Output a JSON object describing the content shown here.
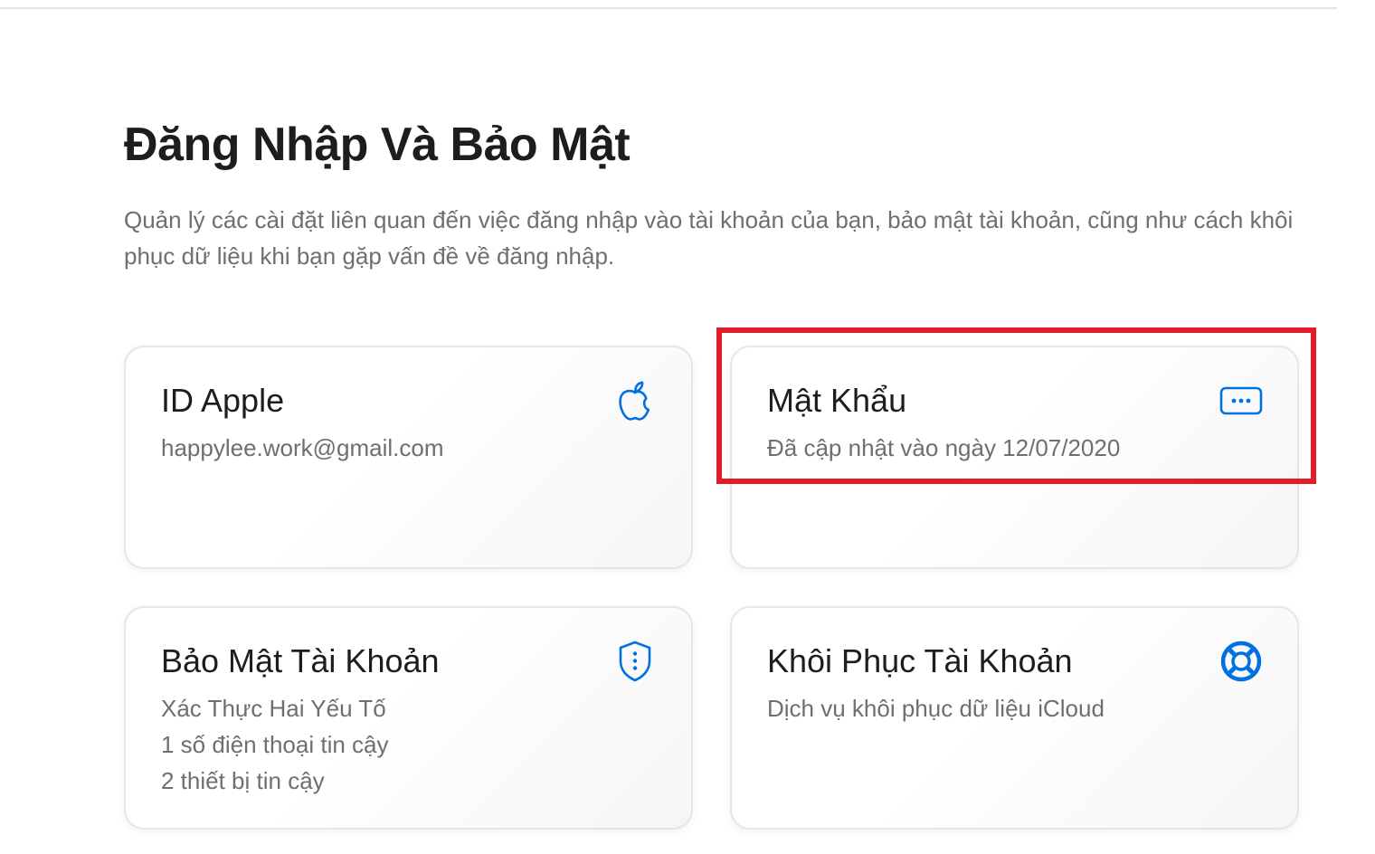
{
  "page": {
    "title": "Đăng Nhập Và Bảo Mật",
    "description": "Quản lý các cài đặt liên quan đến việc đăng nhập vào tài khoản của bạn, bảo mật tài khoản, cũng như cách khôi phục dữ liệu khi bạn gặp vấn đề về đăng nhập."
  },
  "colors": {
    "accent": "#0071e3",
    "highlight": "#e11d2a",
    "title_text": "#1d1d1f",
    "secondary_text": "#6e6e73",
    "card_border": "#e5e5ea"
  },
  "cards": {
    "apple_id": {
      "title": "ID Apple",
      "lines": [
        "happylee.work@gmail.com"
      ],
      "icon": "apple-logo-icon"
    },
    "password": {
      "title": "Mật Khẩu",
      "lines": [
        "Đã cập nhật vào ngày 12/07/2020"
      ],
      "icon": "password-dots-icon",
      "highlighted": true
    },
    "account_security": {
      "title": "Bảo Mật Tài Khoản",
      "lines": [
        "Xác Thực Hai Yếu Tố",
        "1 số điện thoại tin cậy",
        "2 thiết bị tin cậy"
      ],
      "icon": "shield-icon"
    },
    "account_recovery": {
      "title": "Khôi Phục Tài Khoản",
      "lines": [
        "Dịch vụ khôi phục dữ liệu iCloud"
      ],
      "icon": "lifebuoy-icon"
    }
  }
}
